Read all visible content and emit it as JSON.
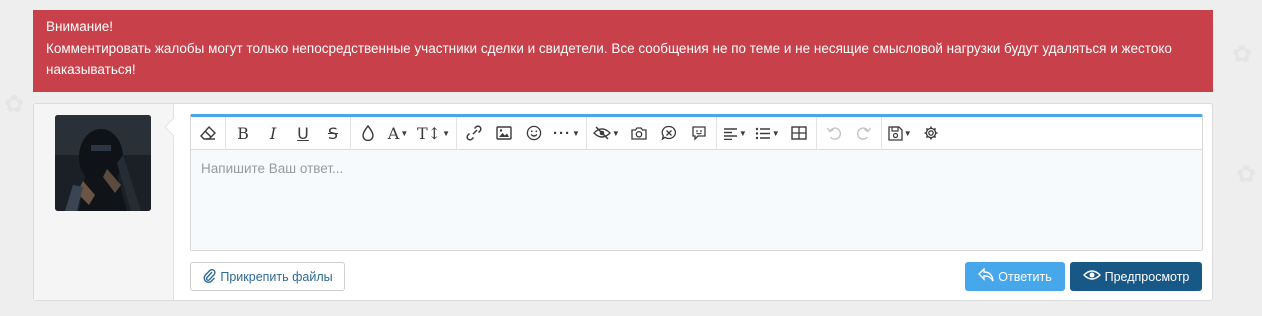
{
  "alert": {
    "title": "Внимание!",
    "message": "Комментировать жалобы могут только непосредственные участники сделки и свидетели. Все сообщения не по теме и не несящие смысловой нагрузки будут удаляться и жестоко наказываться!",
    "background": "#c8404a"
  },
  "editor": {
    "placeholder": "Напишите Ваш ответ...",
    "accent_color": "#47a7eb",
    "toolbar": [
      {
        "name": "remove-format",
        "icon": "eraser-icon",
        "has_dropdown": false
      },
      {
        "name": "bold",
        "icon": "bold-icon",
        "has_dropdown": false
      },
      {
        "name": "italic",
        "icon": "italic-icon",
        "has_dropdown": false
      },
      {
        "name": "underline",
        "icon": "underline-icon",
        "has_dropdown": false
      },
      {
        "name": "strikethrough",
        "icon": "strikethrough-icon",
        "has_dropdown": false
      },
      {
        "name": "text-color",
        "icon": "droplet-icon",
        "has_dropdown": false
      },
      {
        "name": "font-family",
        "icon": "font-icon",
        "has_dropdown": true
      },
      {
        "name": "font-size",
        "icon": "text-height-icon",
        "has_dropdown": true
      },
      {
        "name": "insert-link",
        "icon": "link-icon",
        "has_dropdown": false
      },
      {
        "name": "insert-image",
        "icon": "image-icon",
        "has_dropdown": false
      },
      {
        "name": "insert-smilie",
        "icon": "smile-icon",
        "has_dropdown": false
      },
      {
        "name": "more-options",
        "icon": "ellipsis-icon",
        "has_dropdown": true
      },
      {
        "name": "hide-content",
        "icon": "eye-slash-icon",
        "has_dropdown": true
      },
      {
        "name": "insert-screenshot",
        "icon": "camera-icon",
        "has_dropdown": false
      },
      {
        "name": "insert-quote",
        "icon": "comment-quote-icon",
        "has_dropdown": false
      },
      {
        "name": "insert-spoiler",
        "icon": "comment-dots-icon",
        "has_dropdown": false
      },
      {
        "name": "align",
        "icon": "align-left-icon",
        "has_dropdown": true
      },
      {
        "name": "list",
        "icon": "list-icon",
        "has_dropdown": true
      },
      {
        "name": "insert-table",
        "icon": "table-icon",
        "has_dropdown": false
      },
      {
        "name": "undo",
        "icon": "undo-icon",
        "has_dropdown": false,
        "disabled": true
      },
      {
        "name": "redo",
        "icon": "redo-icon",
        "has_dropdown": false,
        "disabled": true
      },
      {
        "name": "drafts",
        "icon": "save-icon",
        "has_dropdown": true
      },
      {
        "name": "settings",
        "icon": "gear-icon",
        "has_dropdown": false
      }
    ]
  },
  "buttons": {
    "attach_label": "Прикрепить файлы",
    "reply_label": "Ответить",
    "preview_label": "Предпросмотр",
    "reply_color": "#47a7eb",
    "preview_color": "#185886"
  }
}
